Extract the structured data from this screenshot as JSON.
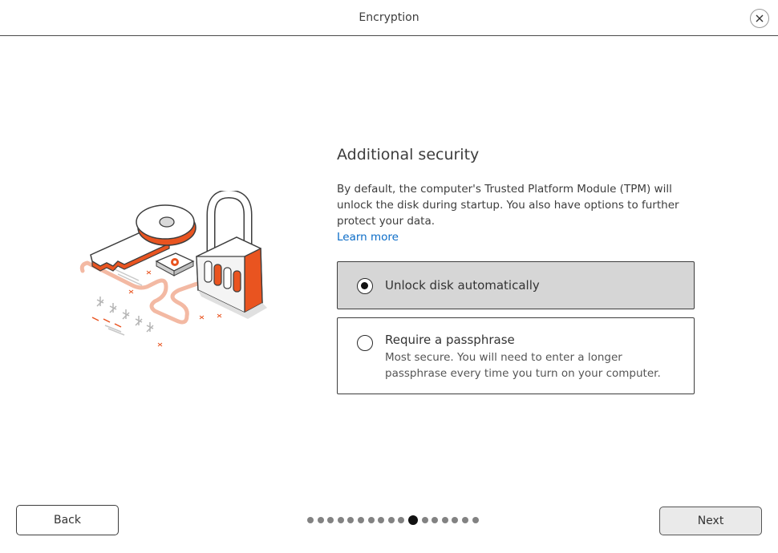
{
  "window": {
    "title": "Encryption"
  },
  "main": {
    "heading": "Additional security",
    "description": "By default, the computer's Trusted Platform Module (TPM) will unlock the disk during startup. You also have options to further protect your data.",
    "learn_more": "Learn more"
  },
  "options": [
    {
      "label": "Unlock disk automatically",
      "selected": true
    },
    {
      "label": "Require a passphrase",
      "description": "Most secure. You will need to enter a longer passphrase every time you turn on your computer.",
      "selected": false
    }
  ],
  "footer": {
    "back_label": "Back",
    "next_label": "Next",
    "progress": {
      "total_steps": 17,
      "current_step": 11
    }
  },
  "colors": {
    "accent": "#e95420",
    "link": "#0b6cc7",
    "selected_bg": "#d6d6d6"
  },
  "icons": {
    "close": "close-icon",
    "illustration": "key-and-padlock-illustration"
  }
}
